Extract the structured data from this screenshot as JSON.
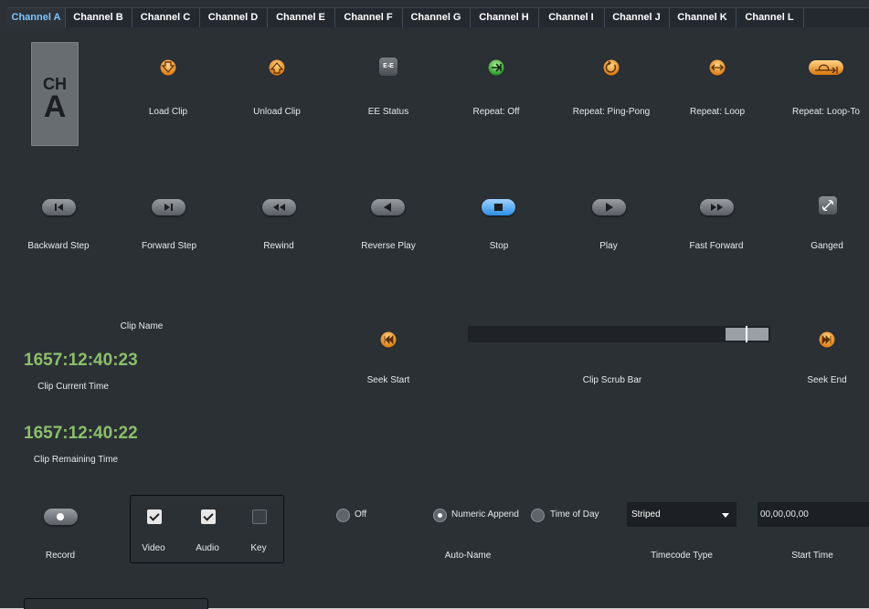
{
  "tabs": [
    "Channel A",
    "Channel B",
    "Channel C",
    "Channel D",
    "Channel E",
    "Channel F",
    "Channel G",
    "Channel H",
    "Channel I",
    "Channel J",
    "Channel K",
    "Channel L"
  ],
  "active_tab": "Channel A",
  "channel_badge": {
    "top": "CH",
    "letter": "A"
  },
  "row1": {
    "load_clip": "Load Clip",
    "unload_clip": "Unload Clip",
    "ee_status": "EE Status",
    "ee_icon_text": "E-E",
    "repeat_off": "Repeat: Off",
    "repeat_ping_pong": "Repeat: Ping-Pong",
    "repeat_loop": "Repeat: Loop",
    "repeat_loop_to": "Repeat: Loop-To"
  },
  "row2": {
    "backward_step": "Backward Step",
    "forward_step": "Forward Step",
    "rewind": "Rewind",
    "reverse_play": "Reverse Play",
    "stop": "Stop",
    "play": "Play",
    "fast_forward": "Fast Forward",
    "ganged": "Ganged"
  },
  "clip": {
    "name_label": "Clip Name",
    "current_time": "1657:12:40:23",
    "current_time_label": "Clip Current Time",
    "remaining_time": "1657:12:40:22",
    "remaining_time_label": "Clip Remaining Time"
  },
  "seek": {
    "start": "Seek Start",
    "scrub_label": "Clip Scrub Bar",
    "end": "Seek End"
  },
  "record": {
    "label": "Record",
    "video": "Video",
    "audio": "Audio",
    "key": "Key",
    "video_checked": true,
    "audio_checked": true,
    "key_checked": false
  },
  "auto_name": {
    "off": "Off",
    "numeric_append": "Numeric Append",
    "time_of_day": "Time of Day",
    "selected": "Numeric Append",
    "label": "Auto-Name"
  },
  "timecode": {
    "value": "Striped",
    "label": "Timecode Type"
  },
  "start_time": {
    "value": "00,00,00,00",
    "label": "Start Time"
  },
  "colors": {
    "timecode_green": "#8cbf6b",
    "accent_blue": "#3d9be9",
    "orange_icon": "#f29a1e",
    "green_icon": "#3fb53f"
  }
}
